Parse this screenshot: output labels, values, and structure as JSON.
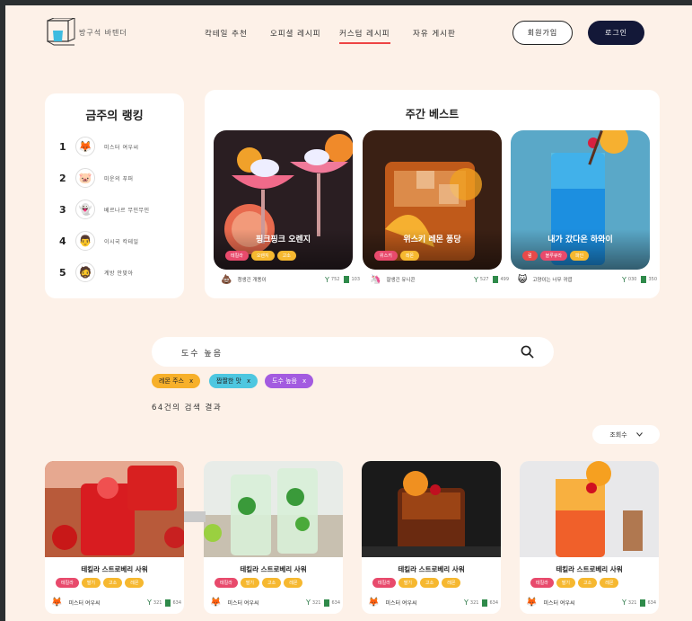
{
  "header": {
    "brand": "방구석 바텐더",
    "nav": [
      "칵테일 추천",
      "오피셜 레시피",
      "커스텀 레시피",
      "자유 게시판"
    ],
    "active_nav": 2,
    "signup_label": "회원가입",
    "login_label": "로그인"
  },
  "ranking": {
    "title": "금주의 랭킹",
    "items": [
      {
        "rank": "1",
        "name": "미스터 여우씨",
        "icon": "fox-icon"
      },
      {
        "rank": "2",
        "name": "미운의 푸퍼",
        "icon": "pig-icon"
      },
      {
        "rank": "3",
        "name": "베르나르 무민무민",
        "icon": "moomin-icon"
      },
      {
        "rank": "4",
        "name": "이시국 칵테일",
        "icon": "man-icon"
      },
      {
        "rank": "5",
        "name": "계방 안맞아",
        "icon": "mustache-icon"
      }
    ]
  },
  "weekly": {
    "title": "주간 베스트",
    "items": [
      {
        "name": "핑크핑크 오렌지",
        "tags": [
          "테킬라",
          "오렌지",
          "고소"
        ],
        "author": "청생긴 개똥이",
        "likes": "752",
        "saves": "103",
        "avatar": "poop-icon"
      },
      {
        "name": "위스키 레몬 퐁당",
        "tags": [
          "위스키",
          "레몬"
        ],
        "author": "잘생긴 유니콘",
        "likes": "527",
        "saves": "499",
        "avatar": "unicorn-icon"
      },
      {
        "name": "내가 갔다온 하와이",
        "tags": [
          "럼",
          "블루큐라",
          "파인"
        ],
        "author": "고양이는 너무 귀엽",
        "likes": "030",
        "saves": "350",
        "avatar": "cat-icon"
      }
    ]
  },
  "search": {
    "query": "도수 높음",
    "filters": [
      {
        "label": "레몬 주스"
      },
      {
        "label": "짭짤한 맛"
      },
      {
        "label": "도수 높음"
      }
    ],
    "filter_close": "x",
    "count_text": "64건의 검색 결과",
    "sort_label": "조회수"
  },
  "results": [
    {
      "name": "테킬라 스트로베리 사워",
      "tags": [
        "테킬라",
        "딸기",
        "고소",
        "레몬"
      ],
      "author": "미스터 여우씨",
      "likes": "321",
      "saves": "634"
    },
    {
      "name": "테킬라 스트로베리 사워",
      "tags": [
        "테킬라",
        "딸기",
        "고소",
        "레몬"
      ],
      "author": "미스터 여우씨",
      "likes": "321",
      "saves": "634"
    },
    {
      "name": "테킬라 스트로베리 사워",
      "tags": [
        "테킬라",
        "딸기",
        "고소",
        "레몬"
      ],
      "author": "미스터 여우씨",
      "likes": "321",
      "saves": "634"
    },
    {
      "name": "테킬라 스트로베리 사워",
      "tags": [
        "테킬라",
        "딸기",
        "고소",
        "레몬"
      ],
      "author": "미스터 여우씨",
      "likes": "321",
      "saves": "634"
    }
  ],
  "colors": {
    "accent": "#131838",
    "active_underline": "#e44444",
    "background": "#fdf1e8"
  }
}
